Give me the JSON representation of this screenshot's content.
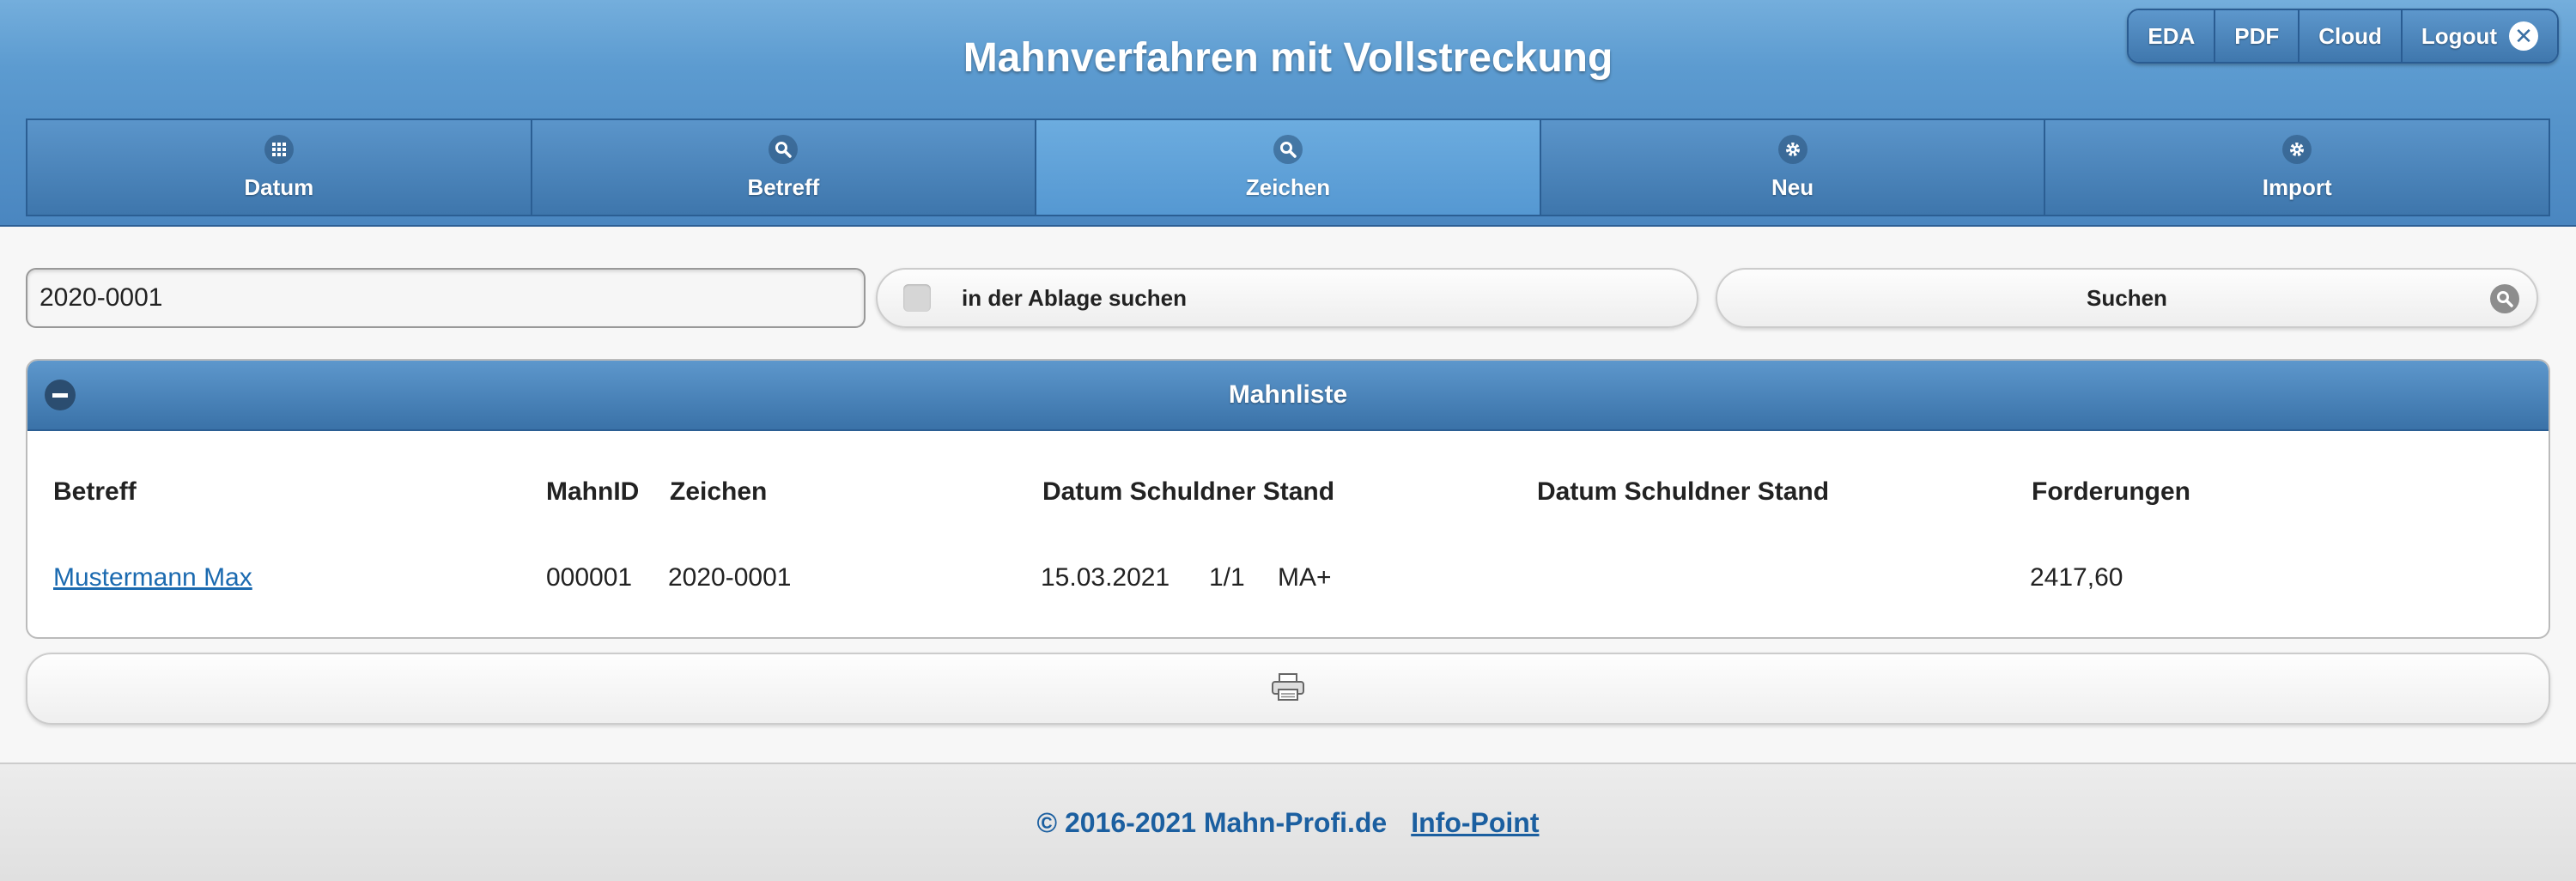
{
  "header": {
    "title": "Mahnverfahren mit Vollstreckung",
    "top_buttons": [
      "EDA",
      "PDF",
      "Cloud",
      "Logout"
    ],
    "nav": [
      {
        "label": "Datum",
        "icon": "grid-icon"
      },
      {
        "label": "Betreff",
        "icon": "search-icon"
      },
      {
        "label": "Zeichen",
        "icon": "search-icon",
        "active": true
      },
      {
        "label": "Neu",
        "icon": "gear-icon"
      },
      {
        "label": "Import",
        "icon": "gear-icon"
      }
    ]
  },
  "search": {
    "value": "2020-0001",
    "archive_label": "in der Ablage suchen",
    "button_label": "Suchen"
  },
  "panel": {
    "title": "Mahnliste",
    "columns": [
      "Betreff",
      "MahnID",
      "Zeichen",
      "Datum Schuldner Stand",
      "Datum Schuldner Stand",
      "Forderungen"
    ],
    "rows": [
      {
        "betreff": "Mustermann Max",
        "mahnid": "000001",
        "zeichen": "2020-0001",
        "datum": "15.03.2021",
        "schuldner": "1/1",
        "stand": "MA+",
        "forderungen": "2417,60"
      }
    ]
  },
  "footer": {
    "copyright": "© 2016-2021 Mahn-Profi.de",
    "link": "Info-Point"
  },
  "colors": {
    "header": "#4a86c0",
    "link": "#1b6ab0"
  }
}
